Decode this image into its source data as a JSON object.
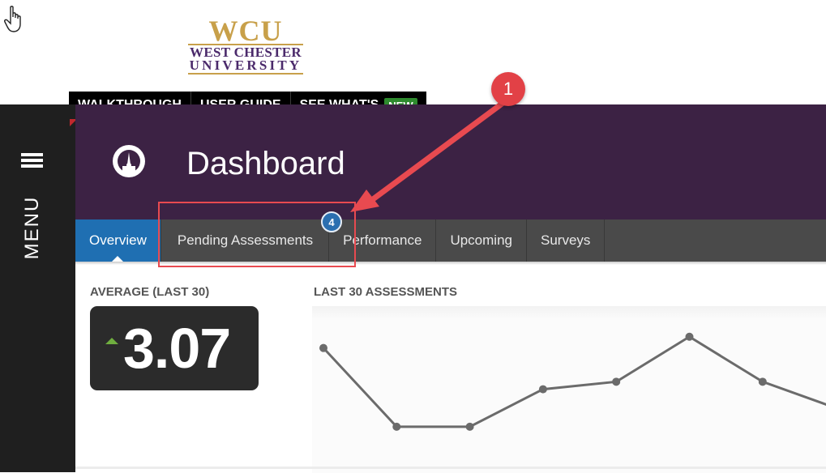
{
  "logo": {
    "line1": "WCU",
    "line2": "WEST CHESTER",
    "line3": "UNIVERSITY"
  },
  "topbar": {
    "items": [
      {
        "label": "WALKTHROUGH"
      },
      {
        "label": "USER GUIDE"
      },
      {
        "label": "SEE WHAT'S",
        "badge": "NEW"
      }
    ]
  },
  "sidebar": {
    "menu_label": "MENU",
    "icon": "hamburger-icon"
  },
  "header": {
    "title": "Dashboard",
    "icon": "dashboard-gauge-icon"
  },
  "tabs": [
    {
      "label": "Overview",
      "active": true
    },
    {
      "label": "Pending Assessments",
      "badge": "4"
    },
    {
      "label": "Performance"
    },
    {
      "label": "Upcoming"
    },
    {
      "label": "Surveys"
    }
  ],
  "average": {
    "label": "AVERAGE (LAST 30)",
    "value": "3.07",
    "trend": "up"
  },
  "chart": {
    "label": "LAST 30 ASSESSMENTS"
  },
  "chart_data": {
    "type": "line",
    "x": [
      1,
      2,
      3,
      4,
      5,
      6,
      7,
      8
    ],
    "values": [
      3.6,
      1.5,
      1.5,
      2.5,
      2.7,
      3.9,
      2.7,
      2.0
    ],
    "ylim": [
      1,
      4.5
    ],
    "grid": false
  },
  "annotation": {
    "step": "1"
  },
  "colors": {
    "header_bg": "#3c2244",
    "tab_active": "#1f6fb2",
    "badge_blue": "#2b6fb0",
    "annotation_red": "#e84a50",
    "new_badge": "#2e8b2e",
    "trend_up": "#6fae3f"
  }
}
